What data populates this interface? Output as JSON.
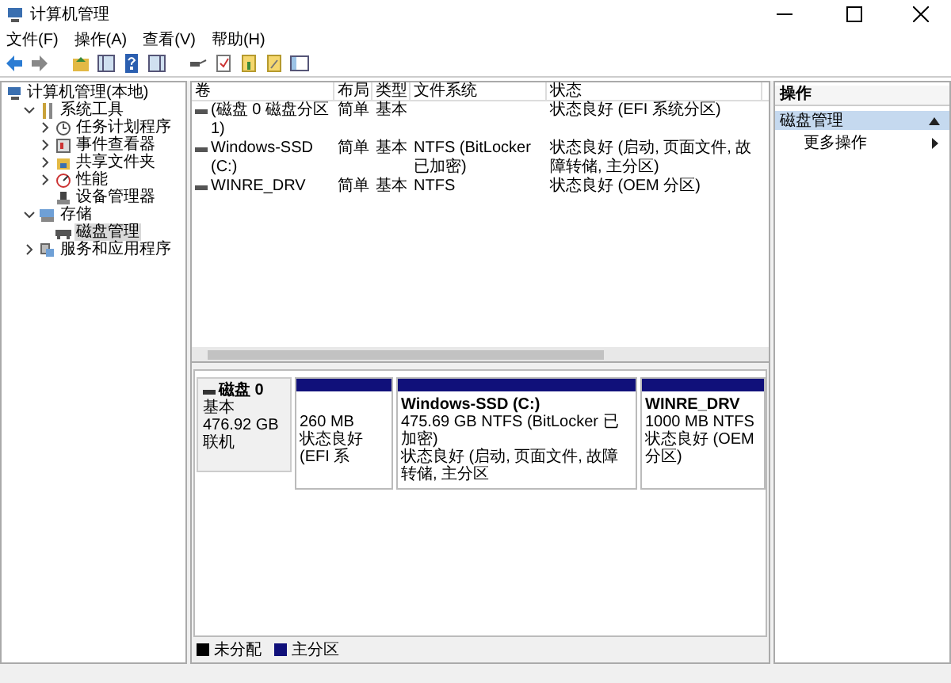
{
  "window": {
    "title": "计算机管理"
  },
  "menu": [
    "文件(F)",
    "操作(A)",
    "查看(V)",
    "帮助(H)"
  ],
  "tree": [
    {
      "label": "计算机管理(本地)",
      "kind": "computer",
      "selected": false,
      "children": [
        {
          "label": "系统工具",
          "kind": "tools",
          "expanded": true,
          "selected": false,
          "children": [
            {
              "label": "任务计划程序",
              "kind": "clock",
              "expanded": false,
              "selected": false
            },
            {
              "label": "事件查看器",
              "kind": "log",
              "expanded": false,
              "selected": false
            },
            {
              "label": "共享文件夹",
              "kind": "folder",
              "expanded": false,
              "selected": false
            },
            {
              "label": "性能",
              "kind": "gauge",
              "expanded": false,
              "selected": false
            },
            {
              "label": "设备管理器",
              "kind": "device",
              "selected": false
            }
          ]
        },
        {
          "label": "存储",
          "kind": "storage",
          "expanded": true,
          "selected": false,
          "children": [
            {
              "label": "磁盘管理",
              "kind": "disk",
              "selected": true
            }
          ]
        },
        {
          "label": "服务和应用程序",
          "kind": "services",
          "expanded": false,
          "selected": false
        }
      ]
    }
  ],
  "table": {
    "columns": [
      "卷",
      "布局",
      "类型",
      "文件系统",
      "状态"
    ],
    "rows": [
      [
        "(磁盘 0 磁盘分区 1)",
        "简单",
        "基本",
        "",
        "状态良好 (EFI 系统分区)"
      ],
      [
        "Windows-SSD (C:)",
        "简单",
        "基本",
        "NTFS (BitLocker 已加密)",
        "状态良好 (启动, 页面文件, 故障转储, 主分区)"
      ],
      [
        "WINRE_DRV",
        "简单",
        "基本",
        "NTFS",
        "状态良好 (OEM 分区)"
      ]
    ]
  },
  "disks": [
    {
      "name": "磁盘 0",
      "type": "基本",
      "size": "476.92 GB",
      "status": "联机",
      "partitions": [
        {
          "size": "260 MB",
          "status": "状态良好 (EFI 系",
          "color": "#10107a"
        },
        {
          "name": "Windows-SSD  (C:)",
          "size": "475.69 GB NTFS (BitLocker 已加密)",
          "status": "状态良好 (启动, 页面文件, 故障转储, 主分区",
          "color": "#10107a"
        },
        {
          "name": "WINRE_DRV",
          "size": "1000 MB NTFS",
          "status": "状态良好 (OEM 分区)",
          "color": "#10107a"
        }
      ]
    }
  ],
  "legend": [
    {
      "label": "未分配",
      "color": "#000000"
    },
    {
      "label": "主分区",
      "color": "#10107a"
    }
  ],
  "actions": {
    "title": "操作",
    "sections": [
      {
        "label": "磁盘管理",
        "expanded": true,
        "items": [
          "更多操作"
        ]
      }
    ]
  }
}
